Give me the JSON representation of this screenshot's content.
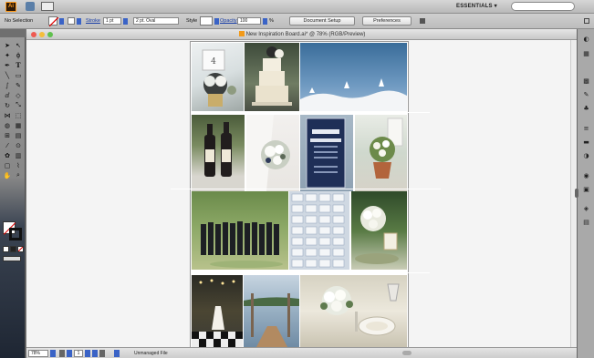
{
  "app": {
    "logo": "Ai",
    "workspace": "ESSENTIALS"
  },
  "control_bar": {
    "selection_label": "No Selection",
    "stroke_label": "Stroke",
    "stroke_weight": "1 pt",
    "brush_profile": "2 pt. Oval",
    "style_label": "Style",
    "opacity_label": "Opacity",
    "opacity_value": "100",
    "opacity_unit": "%",
    "document_setup_button": "Document Setup",
    "preferences_button": "Preferences"
  },
  "document": {
    "title": "New Inspiration Board.ai* @ 78% (RGB/Preview)"
  },
  "status_bar": {
    "zoom": "78%",
    "page": "1",
    "status": "Unmanaged File"
  },
  "tools": [
    "selection-tool",
    "direct-selection-tool",
    "magic-wand-tool",
    "lasso-tool",
    "pen-tool",
    "type-tool",
    "line-tool",
    "rectangle-tool",
    "paintbrush-tool",
    "pencil-tool",
    "blob-brush-tool",
    "eraser-tool",
    "rotate-tool",
    "scale-tool",
    "width-tool",
    "free-transform-tool",
    "shape-builder-tool",
    "perspective-grid-tool",
    "mesh-tool",
    "gradient-tool",
    "eyedropper-tool",
    "blend-tool",
    "symbol-sprayer-tool",
    "column-graph-tool",
    "artboard-tool",
    "slice-tool",
    "hand-tool",
    "zoom-tool"
  ],
  "right_dock": [
    "color-icon",
    "color-guide-icon",
    "swatches-icon",
    "brushes-icon",
    "symbols-icon",
    "stroke-icon",
    "gradient-icon",
    "transparency-icon",
    "appearance-icon",
    "graphic-styles-icon",
    "layers-icon",
    "artboards-icon"
  ],
  "colors": {
    "accent_blue": "#3a63c6",
    "link_blue": "#1a3fa8",
    "canvas": "#f4f4f4",
    "dock_grey": "#a9a9a9"
  }
}
